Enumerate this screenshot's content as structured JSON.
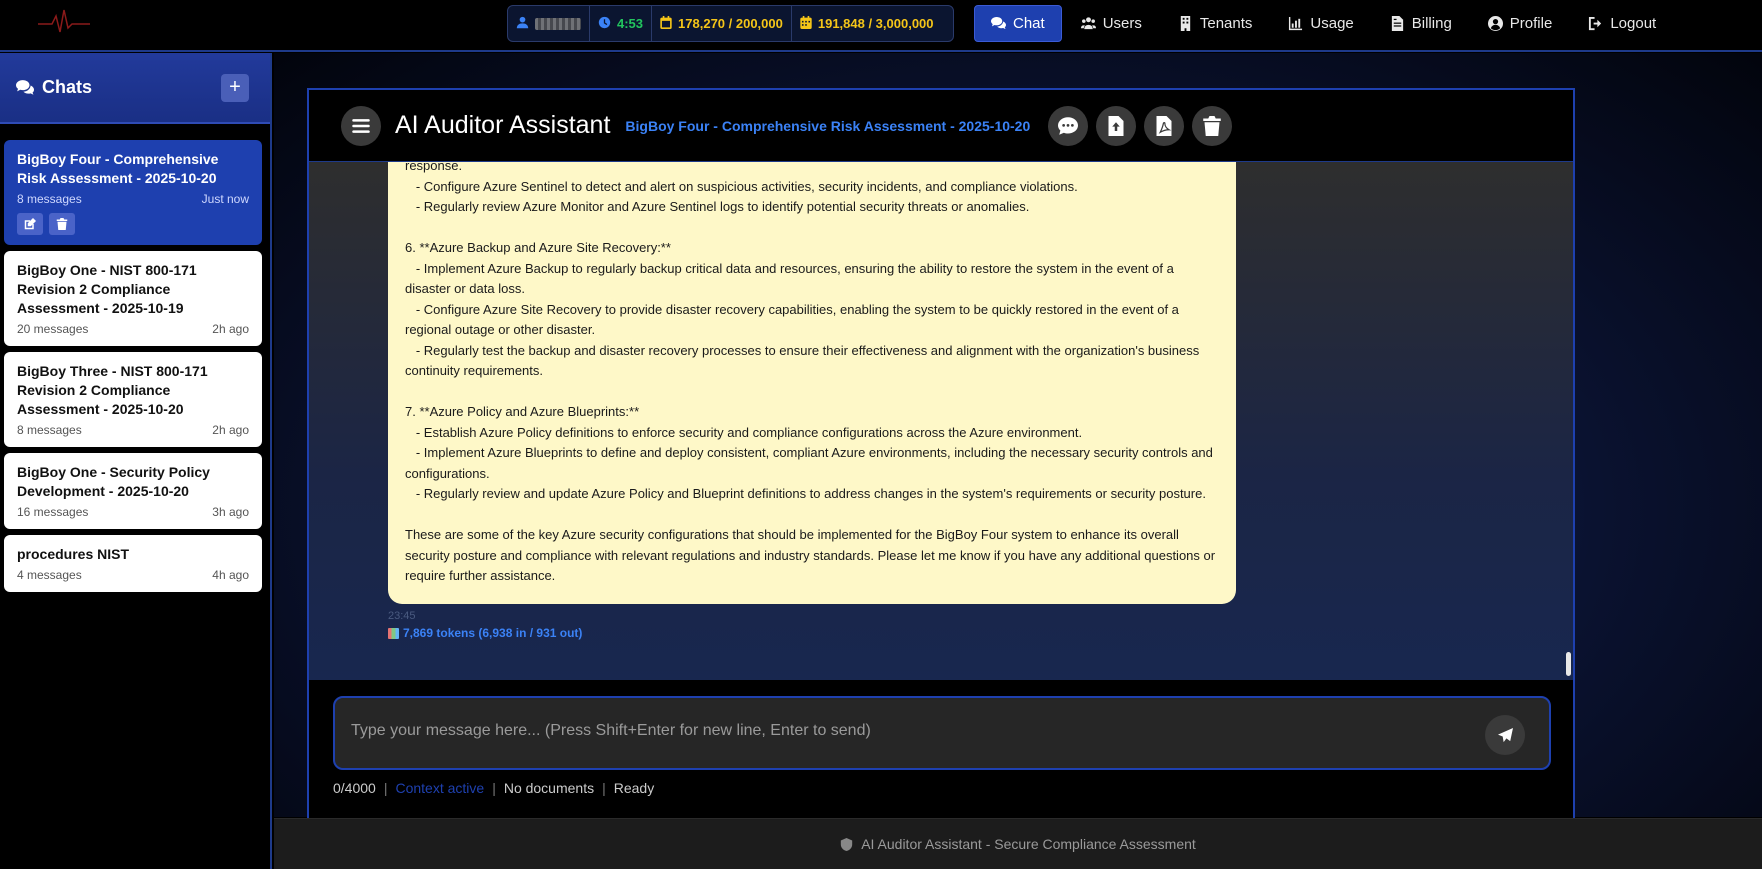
{
  "topbar": {
    "timer": "4:53",
    "usage_1": "178,270 / 200,000",
    "usage_2": "191,848 / 3,000,000",
    "nav": [
      {
        "label": "Chat",
        "icon": "comments-icon"
      },
      {
        "label": "Users",
        "icon": "users-icon"
      },
      {
        "label": "Tenants",
        "icon": "building-icon"
      },
      {
        "label": "Usage",
        "icon": "chart-icon"
      },
      {
        "label": "Billing",
        "icon": "invoice-icon"
      },
      {
        "label": "Profile",
        "icon": "user-circle-icon"
      },
      {
        "label": "Logout",
        "icon": "logout-icon"
      }
    ]
  },
  "sidebar": {
    "title": "Chats",
    "add_label": "+",
    "chats": [
      {
        "title": "BigBoy Four - Comprehensive Risk Assessment - 2025-10-20",
        "count": "8 messages",
        "time": "Just now"
      },
      {
        "title": "BigBoy One - NIST 800-171 Revision 2 Compliance Assessment - 2025-10-19",
        "count": "20 messages",
        "time": "2h ago"
      },
      {
        "title": "BigBoy Three - NIST 800-171 Revision 2 Compliance Assessment - 2025-10-20",
        "count": "8 messages",
        "time": "2h ago"
      },
      {
        "title": "BigBoy One - Security Policy Development - 2025-10-20",
        "count": "16 messages",
        "time": "3h ago"
      },
      {
        "title": "procedures NIST",
        "count": "4 messages",
        "time": "4h ago"
      }
    ]
  },
  "panel": {
    "app_title": "AI Auditor Assistant",
    "subtitle": "BigBoy Four - Comprehensive Risk Assessment - 2025-10-20"
  },
  "message": {
    "text": "response.\n   - Configure Azure Sentinel to detect and alert on suspicious activities, security incidents, and compliance violations.\n   - Regularly review Azure Monitor and Azure Sentinel logs to identify potential security threats or anomalies.\n\n6. **Azure Backup and Azure Site Recovery:**\n   - Implement Azure Backup to regularly backup critical data and resources, ensuring the ability to restore the system in the event of a disaster or data loss.\n   - Configure Azure Site Recovery to provide disaster recovery capabilities, enabling the system to be quickly restored in the event of a regional outage or other disaster.\n   - Regularly test the backup and disaster recovery processes to ensure their effectiveness and alignment with the organization's business continuity requirements.\n\n7. **Azure Policy and Azure Blueprints:**\n   - Establish Azure Policy definitions to enforce security and compliance configurations across the Azure environment.\n   - Implement Azure Blueprints to define and deploy consistent, compliant Azure environments, including the necessary security controls and configurations.\n   - Regularly review and update Azure Policy and Blueprint definitions to address changes in the system's requirements or security posture.\n\nThese are some of the key Azure security configurations that should be implemented for the BigBoy Four system to enhance its overall security posture and compliance with relevant regulations and industry standards. Please let me know if you have any additional questions or require further assistance.",
    "timestamp": "23:45",
    "tokens": "7,869 tokens (6,938 in / 931 out)"
  },
  "composer": {
    "placeholder": "Type your message here... (Press Shift+Enter for new line, Enter to send)",
    "char_count": "0/4000",
    "context": "Context active",
    "documents": "No documents",
    "status": "Ready"
  },
  "footer": {
    "text": "AI Auditor Assistant - Secure Compliance Assessment"
  },
  "colors": {
    "accent": "#1e40af",
    "link": "#3b82f6",
    "bubble": "#fef8c8",
    "timer": "#22c55e",
    "usage": "#f5c518"
  }
}
